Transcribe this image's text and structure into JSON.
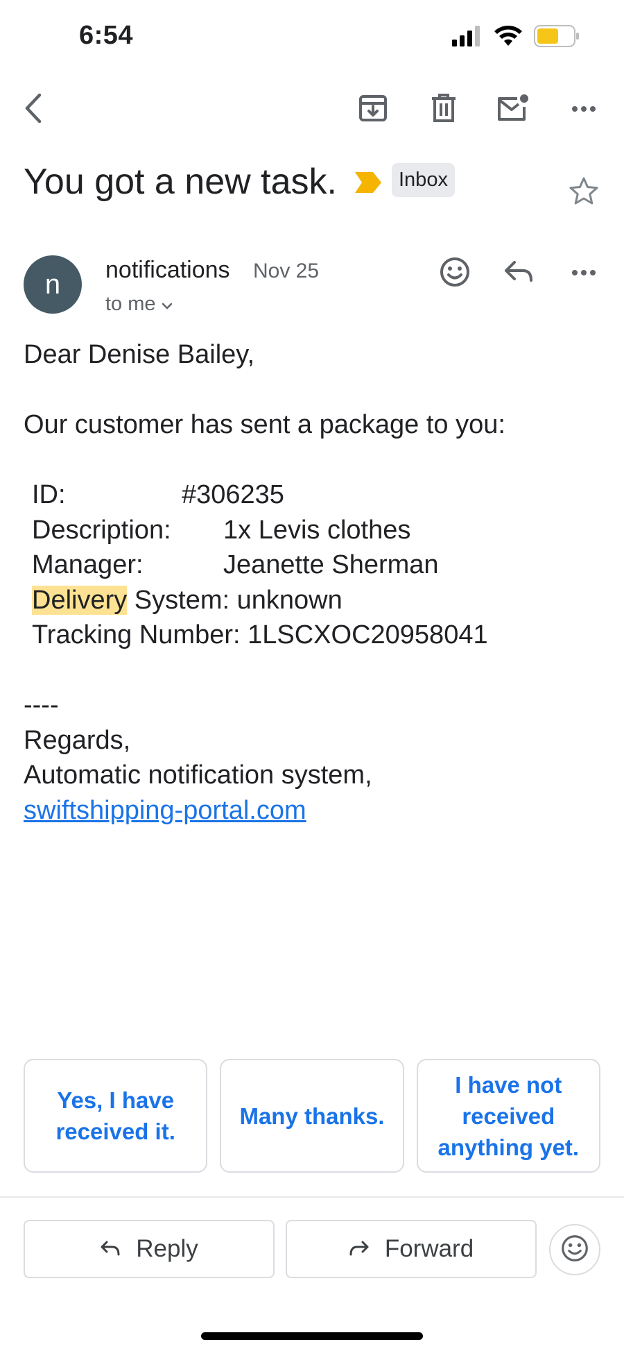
{
  "status_bar": {
    "time": "6:54",
    "icons": [
      "cellular-signal-icon",
      "wifi-icon",
      "battery-icon"
    ],
    "battery_color": "#f5c518"
  },
  "toolbar": {
    "icons": [
      "back-arrow-icon",
      "archive-icon",
      "trash-icon",
      "mark-unread-icon",
      "more-options-icon"
    ]
  },
  "email": {
    "subject": "You got a new task.",
    "label": "Inbox",
    "importance_color": "#f4b400",
    "sender": {
      "avatar_letter": "n",
      "name": "notifications",
      "date": "Nov 25",
      "recipient": "to me"
    },
    "body": {
      "greeting": "Dear Denise Bailey,",
      "intro": "Our customer has sent a package to you:",
      "fields": {
        "id_label": "ID:",
        "id_value": "#306235",
        "description_label": "Description:",
        "description_value": "1x Levis clothes",
        "manager_label": "Manager:",
        "manager_value": "Jeanette Sherman",
        "delivery_highlight": "Delivery",
        "delivery_rest": " System: unknown",
        "tracking": "Tracking Number: 1LSCXOC20958041"
      },
      "separator": "----",
      "regards": "Regards,",
      "signature": "Automatic notification system,",
      "link": "swiftshipping-portal.com"
    }
  },
  "smart_replies": [
    "Yes, I have received it.",
    "Many thanks.",
    "I have not received anything yet."
  ],
  "actions": {
    "reply": "Reply",
    "forward": "Forward"
  },
  "colors": {
    "accent": "#1a73e8",
    "highlight": "#fde293",
    "avatar": "#455a64"
  }
}
